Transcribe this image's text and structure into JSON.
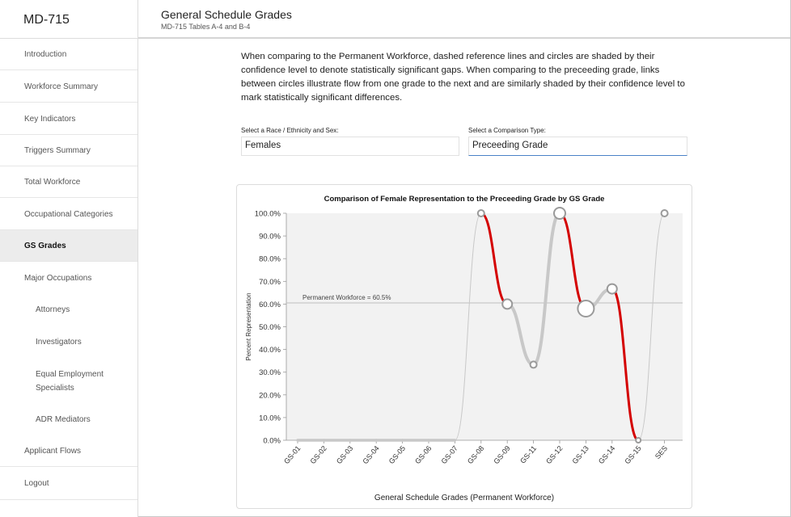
{
  "app": {
    "title": "MD-715"
  },
  "header": {
    "title": "General Schedule Grades",
    "subtitle": "MD-715 Tables A-4 and B-4"
  },
  "sidebar": {
    "items": [
      {
        "label": "Introduction",
        "sub": false,
        "active": false
      },
      {
        "label": "Workforce Summary",
        "sub": false,
        "active": false
      },
      {
        "label": "Key Indicators",
        "sub": false,
        "active": false
      },
      {
        "label": "Triggers Summary",
        "sub": false,
        "active": false
      },
      {
        "label": "Total Workforce",
        "sub": false,
        "active": false
      },
      {
        "label": "Occupational Categories",
        "sub": false,
        "active": false
      },
      {
        "label": "GS Grades",
        "sub": false,
        "active": true
      },
      {
        "label": "Major Occupations",
        "sub": false,
        "active": false
      },
      {
        "label": "Attorneys",
        "sub": true,
        "active": false
      },
      {
        "label": "Investigators",
        "sub": true,
        "active": false
      },
      {
        "label": "Equal Employment Specialists",
        "sub": true,
        "active": false
      },
      {
        "label": "ADR Mediators",
        "sub": true,
        "active": false
      },
      {
        "label": "Applicant Flows",
        "sub": false,
        "active": false
      },
      {
        "label": "Logout",
        "sub": false,
        "active": false
      }
    ]
  },
  "main": {
    "description": "When comparing to the Permanent Workforce, dashed reference lines and circles are shaded by their confidence level to denote statistically significant gaps. When comparing to the preceeding grade, links between circles illustrate flow from one grade to the next and are similarly shaded by their confidence level to mark statistically significant differences.",
    "race_select": {
      "label": "Select a Race / Ethnicity and Sex:",
      "value": "Females"
    },
    "comparison_select": {
      "label": "Select a Comparison Type:",
      "value": "Preceeding Grade"
    }
  },
  "chart_data": {
    "type": "line",
    "title": "Comparison of Female Representation to the Preceeding Grade by GS Grade",
    "xlabel": "General Schedule Grades (Permanent Workforce)",
    "ylabel": "Percent Representation",
    "ylim": [
      0,
      100
    ],
    "yticks": [
      "0.0%",
      "10.0%",
      "20.0%",
      "30.0%",
      "40.0%",
      "50.0%",
      "60.0%",
      "70.0%",
      "80.0%",
      "90.0%",
      "100.0%"
    ],
    "categories": [
      "GS-01",
      "GS-02",
      "GS-03",
      "GS-04",
      "GS-05",
      "GS-06",
      "GS-07",
      "GS-08",
      "GS-09",
      "GS-11",
      "GS-12",
      "GS-13",
      "GS-14",
      "GS-15",
      "SES"
    ],
    "values": [
      0,
      0,
      0,
      0,
      0,
      0,
      0,
      100,
      60,
      33.3,
      100,
      58,
      66.7,
      0,
      100
    ],
    "circles_shown": [
      false,
      false,
      false,
      false,
      false,
      false,
      false,
      true,
      true,
      true,
      true,
      true,
      true,
      true,
      true
    ],
    "reference_line": {
      "value": 60.5,
      "label": "Permanent Workforce = 60.5%"
    },
    "colors": {
      "significant": "#d40000",
      "neutral": "#c8c8c8",
      "reference": "#bdbdbd"
    },
    "significant_links": [
      [
        7,
        8
      ],
      [
        10,
        11
      ],
      [
        12,
        13
      ]
    ]
  }
}
